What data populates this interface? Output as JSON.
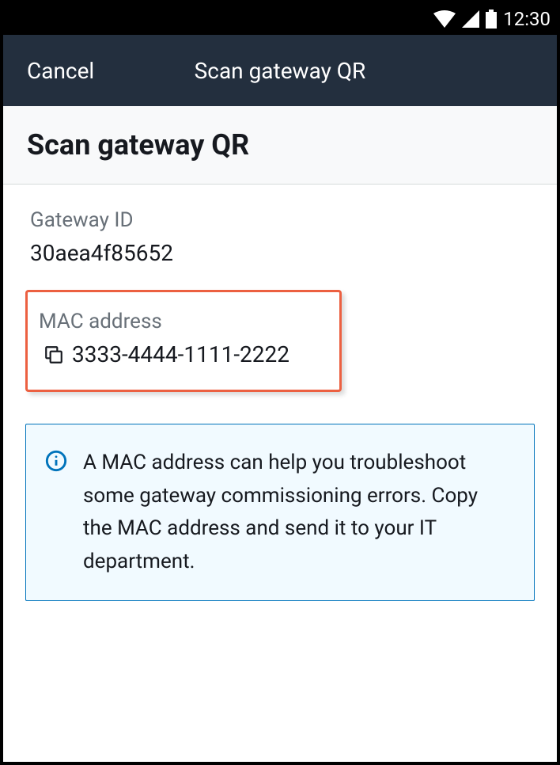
{
  "statusBar": {
    "time": "12:30"
  },
  "navBar": {
    "cancel": "Cancel",
    "title": "Scan gateway QR"
  },
  "subheader": {
    "title": "Scan gateway QR"
  },
  "gateway": {
    "label": "Gateway ID",
    "value": "30aea4f85652"
  },
  "mac": {
    "label": "MAC address",
    "value": "3333-4444-1111-2222"
  },
  "infoBox": {
    "text": "A MAC address can help you troubleshoot some gateway commissioning errors. Copy the MAC address and send it to your IT department."
  }
}
